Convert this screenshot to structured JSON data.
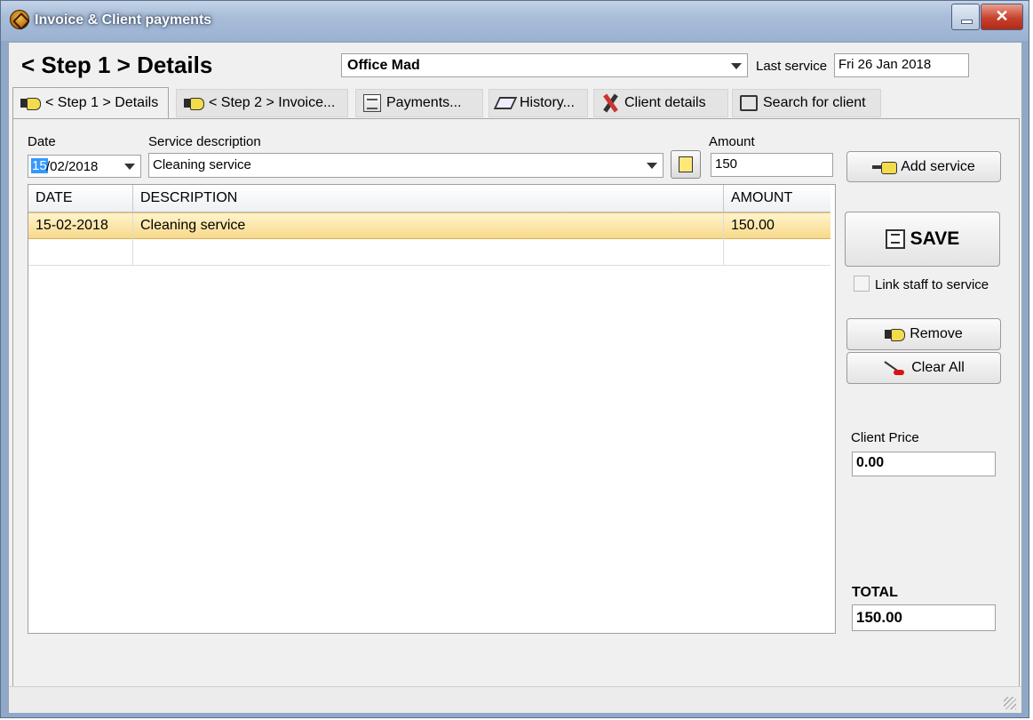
{
  "window": {
    "title": "Invoice & Client payments",
    "close_glyph": "✕"
  },
  "header": {
    "step_title": "< Step 1 > Details",
    "client_name": "Office Mad",
    "last_service_label": "Last service",
    "last_service_value": "Fri 26 Jan 2018"
  },
  "tabs": [
    {
      "label": "< Step 1 > Details",
      "icon": "hand-pointer-icon"
    },
    {
      "label": "< Step 2 > Invoice...",
      "icon": "hand-pointer-icon"
    },
    {
      "label": "Payments...",
      "icon": "document-icon"
    },
    {
      "label": "History...",
      "icon": "book-icon"
    },
    {
      "label": "Client details",
      "icon": "tools-icon"
    },
    {
      "label": "Search for client",
      "icon": "search-icon"
    }
  ],
  "form": {
    "date_label": "Date",
    "date_selected": "15",
    "date_rest": "/02/2018",
    "service_label": "Service description",
    "service_value": "Cleaning service",
    "amount_label": "Amount",
    "amount_value": "150"
  },
  "grid": {
    "columns": [
      "DATE",
      "DESCRIPTION",
      "AMOUNT"
    ],
    "rows": [
      {
        "date": "15-02-2018",
        "description": "Cleaning service",
        "amount": "150.00"
      }
    ]
  },
  "side": {
    "add_service": "Add service",
    "save": "SAVE",
    "link_staff": "Link staff to service",
    "remove": "Remove",
    "clear_all": "Clear All",
    "client_price_label": "Client Price",
    "client_price_value": "0.00",
    "total_label": "TOTAL",
    "total_value": "150.00"
  },
  "colors": {
    "selected_row": "#f7d98a",
    "title_bar": "#a9bdd8",
    "close_button": "#c8412c"
  }
}
